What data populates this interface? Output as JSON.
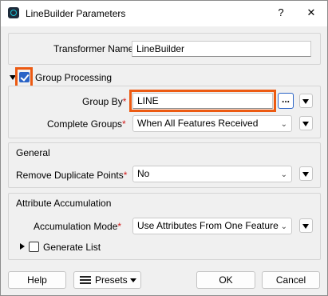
{
  "window": {
    "title": "LineBuilder Parameters",
    "help_glyph": "?",
    "close_glyph": "✕"
  },
  "transformer": {
    "label": "Transformer Name",
    "required_mark": "*",
    "value": "LineBuilder"
  },
  "group_processing": {
    "label": "Group Processing",
    "checked": true,
    "group_by": {
      "label": "Group By",
      "required_mark": "*",
      "value": "LINE",
      "browse_label": "..."
    },
    "complete_groups": {
      "label": "Complete Groups",
      "required_mark": "*",
      "value": "When All Features Received"
    }
  },
  "general": {
    "title": "General",
    "remove_duplicates": {
      "label": "Remove Duplicate Points",
      "required_mark": "*",
      "value": "No"
    }
  },
  "attribute_accumulation": {
    "title": "Attribute Accumulation",
    "mode": {
      "label": "Accumulation Mode",
      "required_mark": "*",
      "value": "Use Attributes From One Feature"
    },
    "generate_list": {
      "label": "Generate List",
      "checked": false
    }
  },
  "footer": {
    "help": "Help",
    "presets": "Presets",
    "ok": "OK",
    "cancel": "Cancel"
  },
  "colors": {
    "highlight": "#ec5a12",
    "checkbox": "#2a63c6",
    "required": "#d21a1a"
  },
  "icons": [
    "app-icon",
    "help-icon",
    "close-icon",
    "chevron-down-icon",
    "menu-triangle-icon",
    "presets-icon",
    "expand-triangle-icon"
  ]
}
